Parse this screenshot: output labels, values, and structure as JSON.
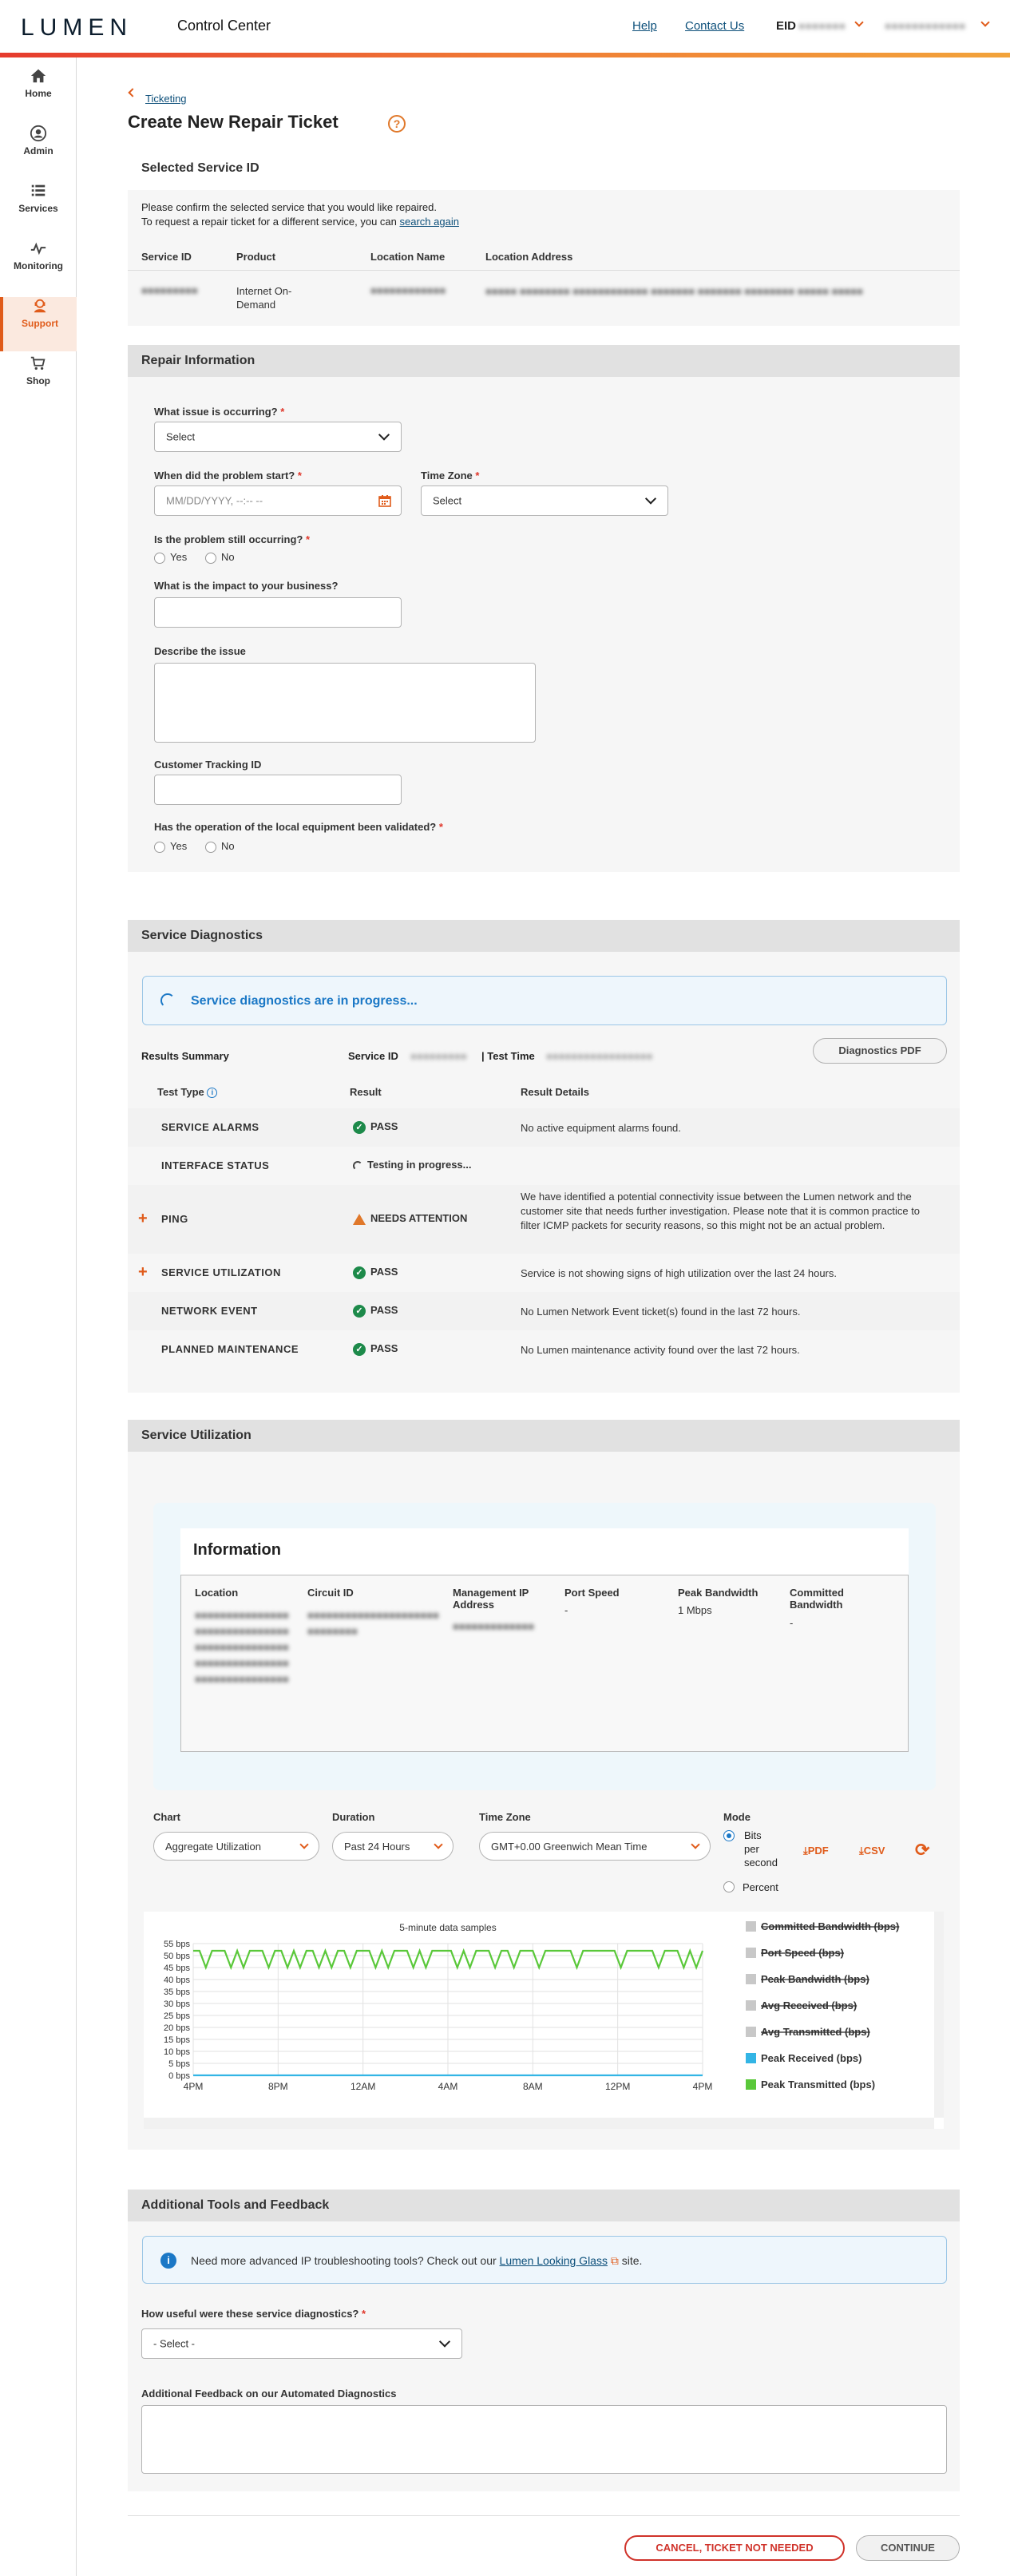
{
  "header": {
    "logo": "LUMEN",
    "app_title": "Control Center",
    "help": "Help",
    "contact": "Contact Us",
    "eid_label": "EID",
    "eid_value": "●●●●●●●",
    "user_name": "●●●●●●●●●●●●"
  },
  "sidebar": {
    "items": [
      {
        "label": "Home",
        "icon": "home-icon"
      },
      {
        "label": "Admin",
        "icon": "user-icon"
      },
      {
        "label": "Services",
        "icon": "list-icon"
      },
      {
        "label": "Monitoring",
        "icon": "pulse-icon"
      },
      {
        "label": "Support",
        "icon": "support-icon",
        "active": true
      },
      {
        "label": "Shop",
        "icon": "cart-icon"
      }
    ]
  },
  "breadcrumb": "Ticketing",
  "page_title": "Create New Repair Ticket",
  "selected_service": {
    "heading": "Selected Service ID",
    "line1": "Please confirm the selected service that you would like repaired.",
    "line2": "To request a repair ticket for a different service, you can",
    "search_again": "search again",
    "col_service_id": "Service ID",
    "col_product": "Product",
    "col_location_name": "Location Name",
    "col_location_address": "Location Address",
    "service_id": "●●●●●●●●●",
    "product": "Internet On-Demand",
    "location_name": "●●●●●●●●●●●●",
    "location_address": "●●●●● ●●●●●●●● ●●●●●●●●●●●● ●●●●●●● ●●●●●●● ●●●●●●●● ●●●●● ●●●●●"
  },
  "repair": {
    "heading": "Repair Information",
    "issue_label": "What issue is occurring?",
    "issue_value": "Select",
    "start_label": "When did the problem start?",
    "start_placeholder": "MM/DD/YYYY, --:-- --",
    "tz_label": "Time Zone",
    "tz_value": "Select",
    "still_label": "Is the problem still occurring?",
    "yes": "Yes",
    "no": "No",
    "impact_label": "What is the impact to your business?",
    "describe_label": "Describe the issue",
    "tracking_label": "Customer Tracking ID",
    "validated_label": "Has the operation of the local equipment been validated?",
    "required_mark": "*"
  },
  "diagnostics": {
    "heading": "Service Diagnostics",
    "progress": "Service diagnostics are in progress...",
    "results_summary": "Results Summary",
    "service_id_label": "Service ID",
    "service_id_value": "●●●●●●●●●",
    "test_time_label": "| Test Time",
    "test_time_value": "●●●●●●●●●●●●●●●●●",
    "pdf_button": "Diagnostics PDF",
    "col_test_type": "Test Type",
    "col_result": "Result",
    "col_details": "Result Details",
    "rows": [
      {
        "type": "SERVICE ALARMS",
        "result": "PASS",
        "status": "pass",
        "details": "No active equipment alarms found.",
        "expand": false
      },
      {
        "type": "INTERFACE STATUS",
        "result": "Testing in progress...",
        "status": "progress",
        "details": "",
        "expand": false
      },
      {
        "type": "PING",
        "result": "NEEDS ATTENTION",
        "status": "warn",
        "details": "We have identified a potential connectivity issue between the Lumen network and the customer site that needs further investigation. Please note that it is common practice to filter ICMP packets for security reasons, so this might not be an actual problem.",
        "expand": true
      },
      {
        "type": "SERVICE UTILIZATION",
        "result": "PASS",
        "status": "pass",
        "details": "Service is not showing signs of high utilization over the last 24 hours.",
        "expand": true
      },
      {
        "type": "NETWORK EVENT",
        "result": "PASS",
        "status": "pass",
        "details": "No Lumen Network Event ticket(s) found in the last 72 hours.",
        "expand": false
      },
      {
        "type": "PLANNED MAINTENANCE",
        "result": "PASS",
        "status": "pass",
        "details": "No Lumen maintenance activity found over the last 72 hours.",
        "expand": false
      }
    ]
  },
  "utilization": {
    "heading": "Service Utilization",
    "info_title": "Information",
    "col_location": "Location",
    "col_circuit": "Circuit ID",
    "col_mgmt_ip": "Management IP Address",
    "col_port_speed": "Port Speed",
    "col_peak_bw": "Peak Bandwidth",
    "col_committed_bw": "Committed Bandwidth",
    "location_value": "●●●●●●●●●●●●●●●●●●●●●●●●●●●●●●●●●●●●●●●●●●●●●●●●●●●●●●●●●●●●●●●●●●●●●●●●●●●",
    "circuit_value": "●●●●●●●●●●●●●●●●●●●●●●●●●●●●●",
    "mgmt_ip_value": "●●●●●●●●●●●●●",
    "port_speed_value": "-",
    "peak_bw_value": "1 Mbps",
    "committed_bw_value": "-",
    "chart_label": "Chart",
    "chart_value": "Aggregate Utilization",
    "duration_label": "Duration",
    "duration_value": "Past 24 Hours",
    "tz_label": "Time Zone",
    "tz_value": "GMT+0.00 Greenwich Mean Time",
    "mode_label": "Mode",
    "mode_bits": "Bits per second",
    "mode_percent": "Percent",
    "pdf": "PDF",
    "csv": "CSV"
  },
  "chart_data": {
    "type": "line",
    "title": "5-minute data samples",
    "x_ticks": [
      "4PM",
      "8PM",
      "12AM",
      "4AM",
      "8AM",
      "12PM",
      "4PM"
    ],
    "y_ticks": [
      "0 bps",
      "5 bps",
      "10 bps",
      "15 bps",
      "20 bps",
      "25 bps",
      "30 bps",
      "35 bps",
      "40 bps",
      "45 bps",
      "50 bps",
      "55 bps"
    ],
    "ylim": [
      0,
      55
    ],
    "series": [
      {
        "name": "Committed Bandwidth (bps)",
        "color": "#c8c8c8",
        "hidden": true
      },
      {
        "name": "Port Speed (bps)",
        "color": "#c8c8c8",
        "hidden": true
      },
      {
        "name": "Peak Bandwidth (bps)",
        "color": "#c8c8c8",
        "hidden": true
      },
      {
        "name": "Avg Received (bps)",
        "color": "#c8c8c8",
        "hidden": true
      },
      {
        "name": "Avg Transmitted (bps)",
        "color": "#c8c8c8",
        "hidden": true
      },
      {
        "name": "Peak Received (bps)",
        "color": "#33b5e5",
        "hidden": false,
        "values": [
          0
        ]
      },
      {
        "name": "Peak Transmitted (bps)",
        "color": "#5ac83a",
        "hidden": false,
        "values": [
          52,
          52,
          45,
          52,
          52,
          52,
          45,
          52,
          45,
          52,
          52,
          52,
          45,
          52,
          52,
          45,
          52,
          45,
          52,
          52,
          45,
          52,
          45,
          52,
          52,
          45,
          52,
          52,
          52,
          45,
          52,
          45,
          52,
          52,
          52,
          45,
          52,
          45,
          52,
          52,
          52,
          52,
          45,
          52,
          45,
          52,
          52,
          52,
          45,
          52,
          52,
          45,
          52,
          52,
          52,
          45,
          52,
          52,
          52,
          52,
          52,
          45,
          52,
          52,
          52,
          52,
          52,
          52,
          45,
          52,
          52,
          52,
          52,
          52,
          45,
          52,
          52,
          52,
          45,
          52,
          45,
          52
        ]
      }
    ]
  },
  "feedback": {
    "heading": "Additional Tools and Feedback",
    "info_text": "Need more advanced IP troubleshooting tools? Check out our",
    "looking_glass": "Lumen Looking Glass",
    "info_suffix": "site.",
    "useful_label": "How useful were these service diagnostics?",
    "useful_value": "- Select -",
    "additional_label": "Additional Feedback on our Automated Diagnostics"
  },
  "footer": {
    "cancel": "CANCEL, TICKET NOT NEEDED",
    "continue": "CONTINUE"
  },
  "colors": {
    "accent": "#e05b1a",
    "link": "#0c4f7a",
    "pass": "#1d8a4a",
    "warn": "#e0782a",
    "info_blue": "#1b78c6"
  }
}
